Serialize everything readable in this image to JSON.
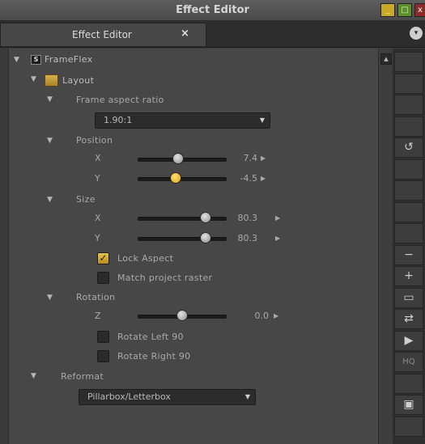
{
  "window": {
    "title": "Effect Editor",
    "minimize_glyph": "_",
    "maximize_glyph": "□",
    "close_glyph": "x"
  },
  "tab": {
    "label": "Effect Editor",
    "close_glyph": "×"
  },
  "tabbar_menu_glyph": "▾",
  "tree": {
    "root": {
      "label": "FrameFlex",
      "icon": "frameflex-effect-icon",
      "icon_glyph": "S"
    },
    "layout": {
      "label": "Layout",
      "icon": "layout-folder-icon"
    },
    "frame_aspect_ratio": {
      "label": "Frame aspect ratio",
      "value": "1.90:1"
    },
    "position": {
      "label": "Position",
      "x": {
        "label": "X",
        "value": "7.4",
        "level": 0.45
      },
      "y": {
        "label": "Y",
        "value": "-4.5",
        "level": 0.42
      }
    },
    "size": {
      "label": "Size",
      "x": {
        "label": "X",
        "value": "80.3",
        "level": 0.8
      },
      "y": {
        "label": "Y",
        "value": "80.3",
        "level": 0.8
      }
    },
    "lock_aspect": {
      "label": "Lock Aspect",
      "checked": true
    },
    "match_project_raster": {
      "label": "Match project raster",
      "checked": false
    },
    "rotation": {
      "label": "Rotation",
      "z": {
        "label": "Z",
        "value": "0.0",
        "level": 0.5
      }
    },
    "rotate_left": {
      "label": "Rotate Left 90",
      "checked": false
    },
    "rotate_right": {
      "label": "Rotate Right 90",
      "checked": false
    },
    "reformat": {
      "label": "Reformat",
      "value": "Pillarbox/Letterbox"
    }
  },
  "toolbar": {
    "buttons": [
      {
        "name": "blank",
        "glyph": ""
      },
      {
        "name": "blank",
        "glyph": ""
      },
      {
        "name": "blank",
        "glyph": ""
      },
      {
        "name": "blank",
        "glyph": ""
      },
      {
        "name": "reset-icon",
        "glyph": "↺"
      },
      {
        "name": "blank",
        "glyph": ""
      },
      {
        "name": "blank",
        "glyph": ""
      },
      {
        "name": "blank",
        "glyph": ""
      },
      {
        "name": "blank",
        "glyph": ""
      },
      {
        "name": "zoom-out-icon",
        "glyph": "−"
      },
      {
        "name": "zoom-in-icon",
        "glyph": "+"
      },
      {
        "name": "split-view-icon",
        "glyph": "▭"
      },
      {
        "name": "swap-icon",
        "glyph": "⇄"
      },
      {
        "name": "play-icon",
        "glyph": "▶"
      },
      {
        "name": "hq-toggle",
        "glyph": "HQ"
      },
      {
        "name": "blank",
        "glyph": ""
      },
      {
        "name": "safe-area-icon",
        "glyph": "▣"
      },
      {
        "name": "blank",
        "glyph": ""
      }
    ]
  },
  "colors": {
    "accent": "#e6c350",
    "panel": "#474747",
    "background": "#3a3a3a"
  }
}
